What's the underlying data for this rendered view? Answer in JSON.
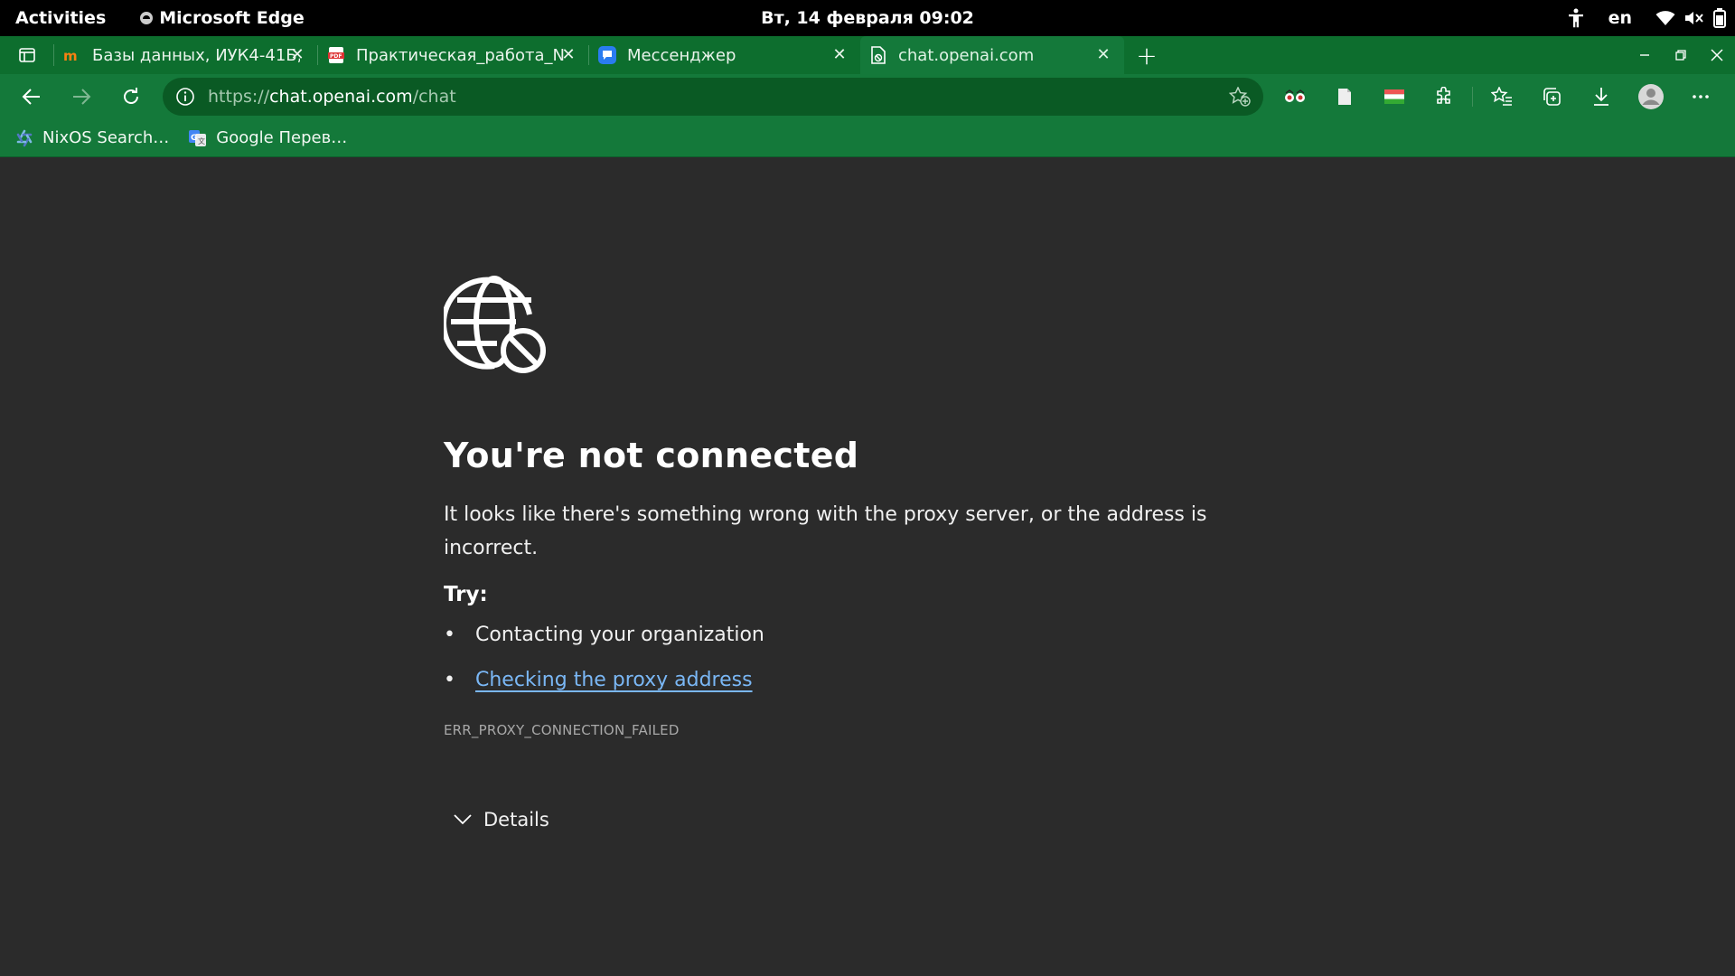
{
  "topbar": {
    "activities": "Activities",
    "app_name": "Microsoft Edge",
    "clock": "Вт, 14 февраля  09:02",
    "keyboard_layout": "en"
  },
  "tabs": [
    {
      "title": "Базы данных, ИУК4-41Б,",
      "favicon": "moodle-icon",
      "active": false
    },
    {
      "title": "Практическая_работа_N",
      "favicon": "pdf-icon",
      "active": false
    },
    {
      "title": "Мессенджер",
      "favicon": "messenger-icon",
      "active": false
    },
    {
      "title": "chat.openai.com",
      "favicon": "broken-page-icon",
      "active": true
    }
  ],
  "address_bar": {
    "scheme": "https://",
    "host": "chat.openai.com",
    "path": "/chat"
  },
  "bookmarks": [
    {
      "label": "NixOS Search…",
      "icon": "nixos-icon"
    },
    {
      "label": "Google Перев…",
      "icon": "google-translate-icon"
    }
  ],
  "error_page": {
    "heading": "You're not connected",
    "description": "It looks like there's something wrong with the proxy server, or the address is incorrect.",
    "try_label": "Try:",
    "suggestions": [
      "Contacting your organization",
      "Checking the proxy address"
    ],
    "error_code": "ERR_PROXY_CONNECTION_FAILED",
    "details_label": "Details"
  },
  "colors": {
    "browser_frame": "#14793a",
    "tab_strip": "#0d6e2e",
    "page_background": "#2b2b2b",
    "link": "#7ab7f5"
  }
}
